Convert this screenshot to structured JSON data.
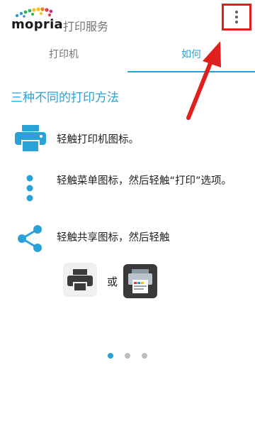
{
  "app": {
    "logo_text": "mopria",
    "title": "打印服务"
  },
  "tabs": [
    {
      "label": "打印机",
      "active": false
    },
    {
      "label": "如何",
      "active": true
    }
  ],
  "section_title": "三种不同的打印方法",
  "steps": [
    {
      "icon": "printer-icon",
      "text": "轻触打印机图标。"
    },
    {
      "icon": "more-vert-icon",
      "text": "轻触菜单图标，然后轻触“打印”选项。"
    },
    {
      "icon": "share-icon",
      "text": "轻触共享图标，然后轻触"
    }
  ],
  "or_text": "或",
  "pager": {
    "pages": 3,
    "current": 1
  },
  "colors": {
    "accent": "#29a3d7",
    "annotation": "#e0201d",
    "text": "#222222",
    "muted": "#757575"
  }
}
